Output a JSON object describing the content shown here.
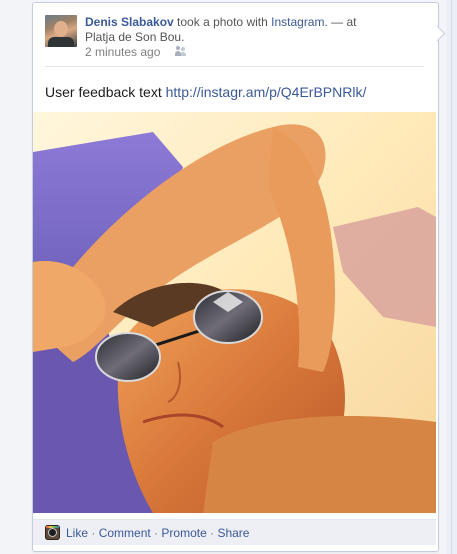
{
  "story": {
    "author": "Denis Slabakov",
    "verb_text": " took a photo with ",
    "app_name": "Instagram",
    "at_text": ". — at ",
    "place": "Platja de Son Bou",
    "place_suffix": ".",
    "timestamp": "2 minutes ago",
    "privacy_icon": "friends-icon"
  },
  "message": {
    "text": "User feedback text",
    "link": "http://instagr.am/p/Q4ErBPNRlk/"
  },
  "actions": {
    "app_icon": "instagram-icon",
    "like": "Like",
    "comment": "Comment",
    "promote": "Promote",
    "share": "Share",
    "separator": "·"
  },
  "colors": {
    "link": "#3b5998",
    "action_bar_bg": "#edeff4",
    "card_border": "#c4cde0"
  }
}
